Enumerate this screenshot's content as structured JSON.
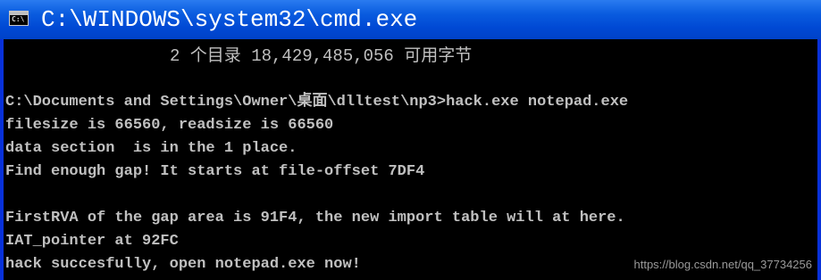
{
  "window": {
    "title": "C:\\WINDOWS\\system32\\cmd.exe",
    "icon": "cmd-icon",
    "icon_glyph": "C:\\"
  },
  "console": {
    "lines": [
      "2 个目录 18,429,485,056 可用字节",
      "C:\\Documents and Settings\\Owner\\桌面\\dlltest\\np3>hack.exe notepad.exe",
      "filesize is 66560, readsize is 66560",
      "data section  is in the 1 place.",
      "Find enough gap! It starts at file-offset 7DF4",
      "FirstRVA of the gap area is 91F4, the new import table will at here.",
      "IAT_pointer at 92FC",
      "hack succesfully, open notepad.exe now!"
    ]
  },
  "watermark": "https://blog.csdn.net/qq_37734256",
  "colors": {
    "titlebar": "#0054e3",
    "console_bg": "#000000",
    "console_text": "#c0c0c0"
  }
}
